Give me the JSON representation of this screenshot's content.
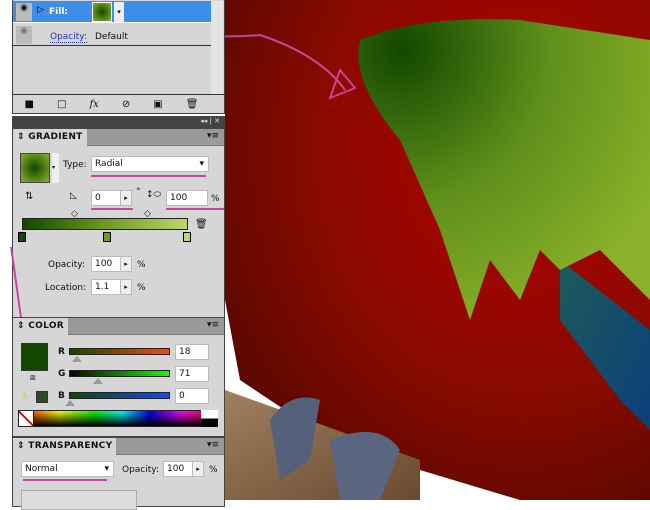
{
  "appearance": {
    "fill_label": "Fill:",
    "opacity_label": "Opacity:",
    "opacity_value": "Default",
    "toolbar_icons": [
      "new-art-icon",
      "square-icon",
      "fx-icon",
      "clear-icon",
      "duplicate-icon",
      "trash-icon"
    ]
  },
  "gradient": {
    "title": "GRADIENT",
    "type_label": "Type:",
    "type_value": "Radial",
    "angle_value": "0",
    "degree_symbol": "°",
    "aspect_value": "100",
    "percent": "%",
    "opacity_label": "Opacity:",
    "opacity_value": "100",
    "location_label": "Location:",
    "location_value": "1.1",
    "stops": [
      {
        "color": "#124700",
        "location": 0
      },
      {
        "color": "#6e9a1e",
        "location": 50
      },
      {
        "color": "#bcd86a",
        "location": 100
      }
    ]
  },
  "color": {
    "title": "COLOR",
    "r_label": "R",
    "g_label": "G",
    "b_label": "B",
    "r": "18",
    "g": "71",
    "b": "0",
    "swatch": "#124700"
  },
  "transparency": {
    "title": "TRANSPARENCY",
    "blend_mode": "Normal",
    "opacity_label": "Opacity:",
    "opacity_value": "100",
    "percent": "%"
  }
}
